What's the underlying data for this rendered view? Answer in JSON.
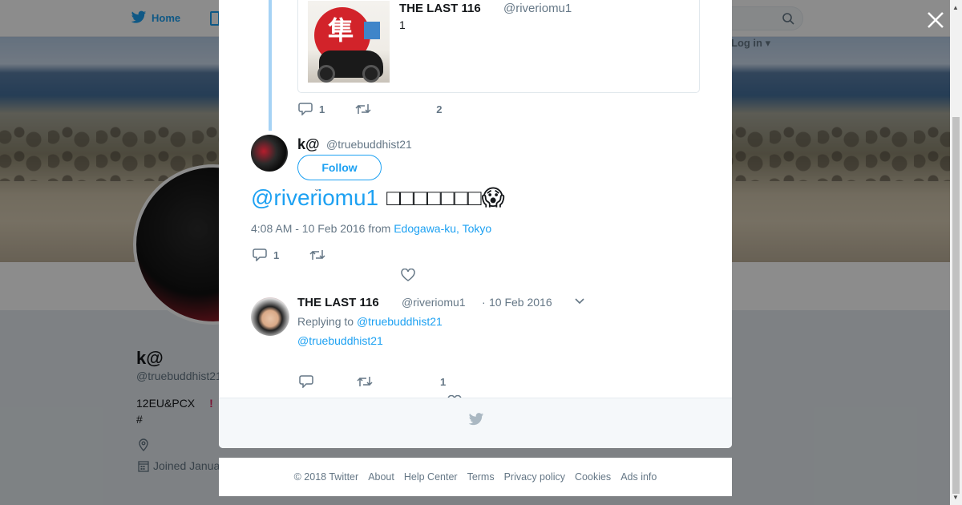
{
  "nav": {
    "home_label": "Home",
    "login_label": "Log in"
  },
  "profile": {
    "name": "k@",
    "handle": "@truebuddhist21",
    "bio_line1": "12EU&PCX",
    "bio_mark": "!",
    "bio_line2": "#",
    "joined": "Joined Janua"
  },
  "quoted_tweet": {
    "name": "THE LAST 116",
    "handle": "@riveriomu1",
    "text": "1",
    "image_text": "隼",
    "reply_count": "1",
    "like_count": "2"
  },
  "main_tweet": {
    "name": "k@",
    "handle": "@truebuddhist21",
    "follow_label": "Follow",
    "mention": "@riveriomu1",
    "body": "□□□□□□□",
    "emoji": "😱",
    "timestamp": "4:08 AM - 10 Feb 2016",
    "from_label": "from",
    "location": "Edogawa-ku, Tokyo",
    "reply_count": "1"
  },
  "reply_tweet": {
    "name": "THE LAST 116",
    "handle": "@riveriomu1",
    "separator": "·",
    "date": "10 Feb 2016",
    "replying_label": "Replying to",
    "replying_to": "@truebuddhist21",
    "text": "@truebuddhist21",
    "like_count": "1"
  },
  "footer_links": {
    "copyright": "© 2018 Twitter",
    "about": "About",
    "help": "Help Center",
    "terms": "Terms",
    "privacy": "Privacy policy",
    "cookies": "Cookies",
    "ads": "Ads info"
  },
  "colors": {
    "accent": "#1da1f2",
    "muted": "#657786",
    "text": "#14171a",
    "thread": "#a6d3f5"
  },
  "icons": [
    "twitter-bird-icon",
    "search-icon",
    "close-icon",
    "reply-icon",
    "retweet-icon",
    "heart-icon",
    "chevron-down-icon",
    "map-pin-icon",
    "calendar-icon"
  ]
}
